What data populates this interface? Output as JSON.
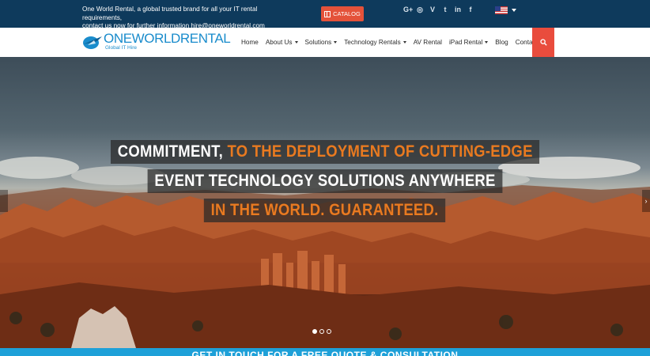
{
  "topbar": {
    "tagline_line1": "One World Rental, a global trusted brand for all your IT rental requirements,",
    "tagline_line2": "contact us now for further information hire@oneworldrental.com",
    "catalog_label": "CATALOG",
    "social": [
      "G+",
      "◎",
      "V",
      "t",
      "in",
      "f"
    ],
    "flag_icon": "us-flag-icon"
  },
  "header": {
    "logo_word": "ONEWORLDRENTAL",
    "logo_sub": "Global IT Hire",
    "nav": [
      {
        "label": "Home",
        "dropdown": false
      },
      {
        "label": "About Us",
        "dropdown": true
      },
      {
        "label": "Solutions",
        "dropdown": true
      },
      {
        "label": "Technology Rentals",
        "dropdown": true
      },
      {
        "label": "AV Rental",
        "dropdown": false
      },
      {
        "label": "iPad Rental",
        "dropdown": true
      },
      {
        "label": "Blog",
        "dropdown": false
      },
      {
        "label": "Contact Us",
        "dropdown": false
      }
    ],
    "search_icon": "search-icon"
  },
  "hero": {
    "line1_white": "COMMITMENT,",
    "line1_orange": "TO THE DEPLOYMENT OF CUTTING-EDGE",
    "line2": "EVENT TECHNOLOGY SOLUTIONS ANYWHERE",
    "line3": "IN THE WORLD. GUARANTEED.",
    "next_arrow": "›",
    "slides": 3,
    "active_slide": 1
  },
  "cta": {
    "text": "GET IN TOUCH FOR A FREE QUOTE & CONSULTATION"
  },
  "colors": {
    "topbar": "#0e3a5c",
    "accent_red": "#e94c3d",
    "brand_blue": "#1a8ccc",
    "headline_orange": "#e97a20",
    "cta_blue": "#1ea0d8"
  }
}
